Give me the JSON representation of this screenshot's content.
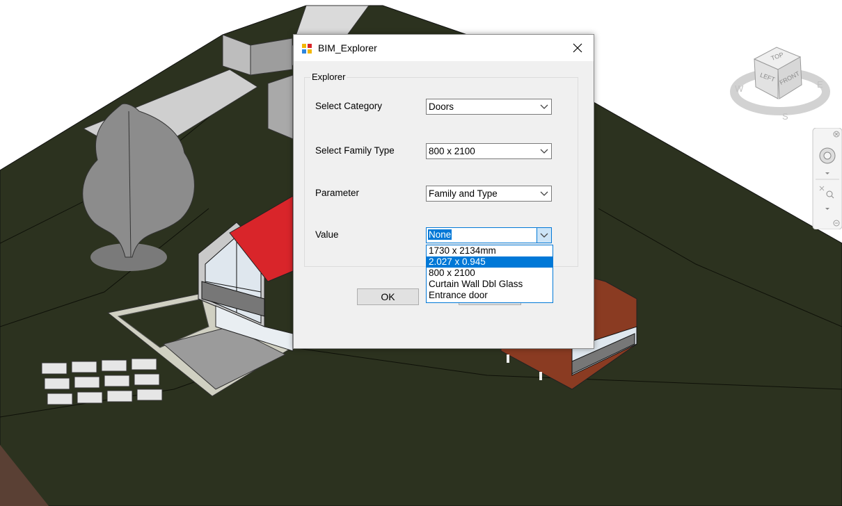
{
  "dialog": {
    "title": "BIM_Explorer",
    "group_title": "Explorer",
    "fields": [
      {
        "label": "Select Category",
        "value": "Doors"
      },
      {
        "label": "Select Family Type",
        "value": "800 x 2100"
      },
      {
        "label": "Parameter",
        "value": "Family and Type"
      },
      {
        "label": "Value",
        "value": "None"
      }
    ],
    "dropdown_options": [
      "1730 x 2134mm",
      "2.027 x 0.945",
      "800 x 2100",
      "Curtain Wall Dbl Glass",
      "Entrance door"
    ],
    "dropdown_selected_index": 1,
    "ok_label": "OK"
  },
  "viewcube": {
    "faces": [
      "TOP",
      "LEFT",
      "FRONT"
    ],
    "compass": [
      "W",
      "E",
      "S"
    ]
  },
  "colors": {
    "terrain": "#2c321f",
    "roof": "#d9252a",
    "selection": "#0078d7",
    "wood": "#8a3b22"
  }
}
